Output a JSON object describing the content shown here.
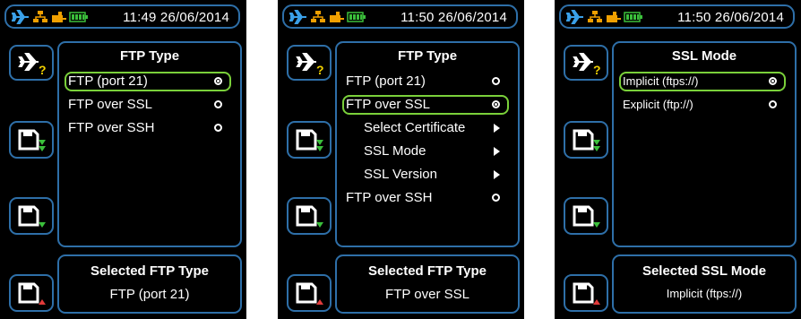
{
  "colors": {
    "border": "#2e6fa8",
    "selection": "#7ad03a",
    "plane": "#3aa0e8",
    "network": "#f0a000",
    "battery": "#3bbf3b",
    "down_arrow": "#3bbf3b",
    "up_arrow": "#e23b3b",
    "question": "#f0d000"
  },
  "icons": [
    "airplane-mode-icon",
    "network-icon",
    "ethernet-icon",
    "battery-icon",
    "airplane-help-icon",
    "save-down-icon",
    "save-up-icon"
  ],
  "screens": [
    {
      "status_time": "11:49 26/06/2014",
      "panel_title": "FTP Type",
      "items": [
        {
          "label": "FTP (port 21)",
          "type": "radio",
          "checked": true,
          "selected": true
        },
        {
          "label": "FTP over SSL",
          "type": "radio",
          "checked": false
        },
        {
          "label": "FTP over SSH",
          "type": "radio",
          "checked": false
        }
      ],
      "bottom_title": "Selected FTP Type",
      "bottom_value": "FTP (port 21)"
    },
    {
      "status_time": "11:50 26/06/2014",
      "panel_title": "FTP Type",
      "items": [
        {
          "label": "FTP (port 21)",
          "type": "radio",
          "checked": false
        },
        {
          "label": "FTP over SSL",
          "type": "radio",
          "checked": true,
          "selected": true
        },
        {
          "label": "Select Certificate",
          "type": "submenu"
        },
        {
          "label": "SSL Mode",
          "type": "submenu"
        },
        {
          "label": "SSL Version",
          "type": "submenu"
        },
        {
          "label": "FTP over SSH",
          "type": "radio",
          "checked": false
        }
      ],
      "bottom_title": "Selected FTP Type",
      "bottom_value": "FTP over SSL"
    },
    {
      "status_time": "11:50 26/06/2014",
      "panel_title": "SSL Mode",
      "items": [
        {
          "label": "Implicit (ftps://)",
          "type": "radio",
          "checked": true,
          "selected": true
        },
        {
          "label": "Explicit (ftp://)",
          "type": "radio",
          "checked": false
        }
      ],
      "bottom_title": "Selected SSL Mode",
      "bottom_value": "Implicit (ftps://)"
    }
  ]
}
